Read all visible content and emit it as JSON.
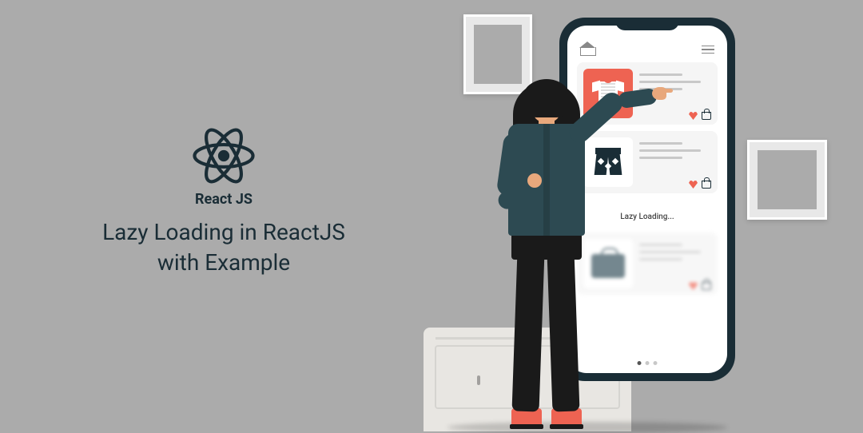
{
  "left": {
    "logo_label": "React JS",
    "title_line1": "Lazy Loading in ReactJS",
    "title_line2": "with Example"
  },
  "phone": {
    "loading_text": "Lazy Loading...",
    "cards": [
      {
        "thumb": "tshirt",
        "bg": "red"
      },
      {
        "thumb": "shorts",
        "bg": "white"
      },
      {
        "thumb": "bag",
        "bg": "white"
      }
    ]
  },
  "colors": {
    "bg": "#ababab",
    "dark": "#1a2d36",
    "accent": "#ee6352",
    "jacket": "#2d4a52"
  }
}
